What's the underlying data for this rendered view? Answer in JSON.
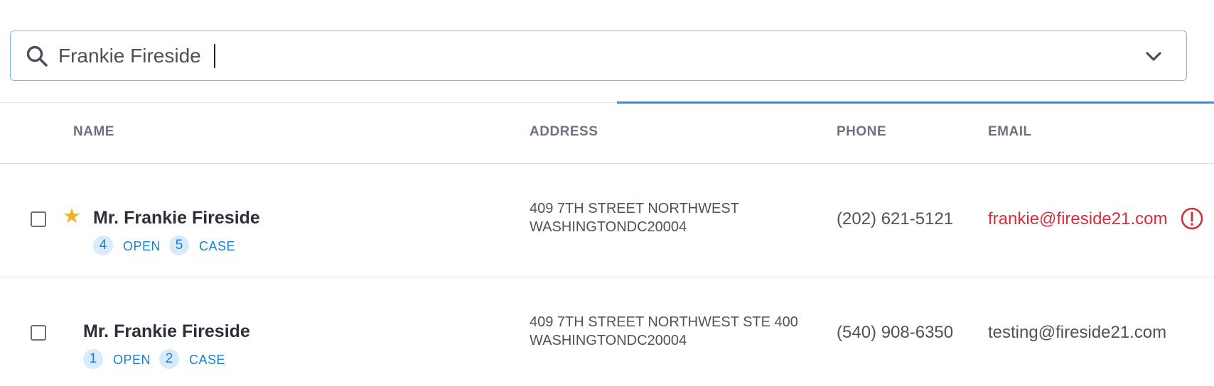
{
  "search": {
    "value": "Frankie Fireside"
  },
  "table": {
    "headers": {
      "name": "NAME",
      "address": "ADDRESS",
      "phone": "PHONE",
      "email": "EMAIL"
    },
    "rows": [
      {
        "starred": true,
        "name": "Mr. Frankie Fireside",
        "open_count": "4",
        "open_label": "OPEN",
        "case_count": "5",
        "case_label": "CASE",
        "address_line1": "409 7TH STREET NORTHWEST",
        "address_line2": "WASHINGTONDC20004",
        "phone": "(202) 621-5121",
        "email": "frankie@fireside21.com",
        "email_color": "#d32f3a",
        "email_warning": true
      },
      {
        "starred": false,
        "name": "Mr. Frankie Fireside",
        "open_count": "1",
        "open_label": "OPEN",
        "case_count": "2",
        "case_label": "CASE",
        "address_line1": "409 7TH STREET NORTHWEST STE 400",
        "address_line2": "WASHINGTONDC20004",
        "phone": "(540) 908-6350",
        "email": "testing@fireside21.com",
        "email_color": "#4d525c",
        "email_warning": false
      }
    ]
  },
  "colors": {
    "accent": "#2f8fe0",
    "star": "#f0b321",
    "badge_bg": "#d7ebfb",
    "badge_text": "#1a7fd6",
    "warning": "#d32f3a"
  }
}
